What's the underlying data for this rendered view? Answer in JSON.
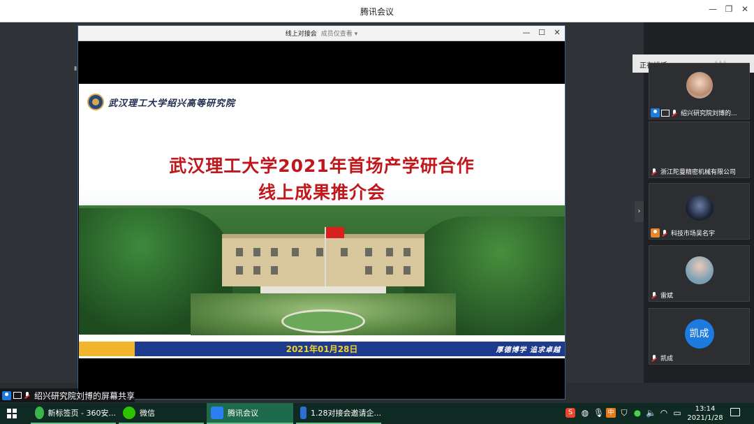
{
  "app": {
    "title": "腾讯会议"
  },
  "share_window": {
    "title": "线上对接会",
    "mode": "成员仅查看",
    "mode_caret": "▾"
  },
  "slide": {
    "institute": "武汉理工大学绍兴高等研究院",
    "title_line1": "武汉理工大学2021年首场产学研合作",
    "title_line2": "线上成果推介会",
    "date": "2021年01月28日",
    "motto": "厚德博学 追求卓越"
  },
  "sidebar": {
    "speaking_label": "正在讲话:",
    "participants": [
      {
        "name": "绍兴研究院刘博的..."
      },
      {
        "name": "浙江陀曼精密机械有限公司"
      },
      {
        "name": "科技市场吴名宇"
      },
      {
        "name": "雷斌"
      },
      {
        "name": "凯成",
        "avatar_text": "凯成"
      }
    ]
  },
  "share_banner": {
    "text": "绍兴研究院刘博的屏幕共享"
  },
  "taskbar": {
    "items": [
      {
        "label": "新标签页 - 360安..."
      },
      {
        "label": "微信"
      },
      {
        "label": "腾讯会议"
      },
      {
        "label": "1.28对接会邀请企..."
      }
    ],
    "time": "13:14",
    "date": "2021/1/28"
  },
  "colors": {
    "slide_title": "#c0171c",
    "band_blue": "#1d3a8c",
    "band_yellow": "#f2b52e",
    "taskbar_bg": "#0f2a22",
    "active_task": "#1e6a4c",
    "accent_blue": "#1d7be0"
  }
}
